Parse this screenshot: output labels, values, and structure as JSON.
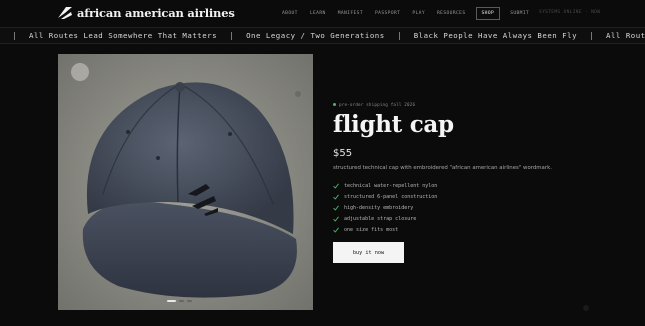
{
  "brand": {
    "name": "african american airlines",
    "logo_icon": "plane-wing-logo-icon"
  },
  "nav": {
    "links": [
      "ABOUT",
      "LEARN",
      "MANIFEST",
      "PASSPORT",
      "PLAY",
      "RESOURCES",
      "SHOP",
      "SUBMIT"
    ],
    "active": "SHOP",
    "status": "SYSTEMS ONLINE · NOW"
  },
  "ticker": {
    "items": [
      "All Routes Lead Somewhere That Matters",
      "One Legacy / Two Generations",
      "Black People Have Always Been Fly",
      "All Routes Lead"
    ]
  },
  "gallery": {
    "image_alt": "faded navy blue cap with embroidered logo",
    "slides": 3,
    "active_slide": 0
  },
  "product": {
    "eyebrow": "pre-order shipping fall 2026",
    "title": "flight cap",
    "price": "$55",
    "description": "structured technical cap with embroidered \"african american airlines\" wordmark.",
    "features": [
      "technical water-repellent nylon",
      "structured 6-panel construction",
      "high-density embroidery",
      "adjustable strap closure",
      "one size fits most"
    ],
    "buy_label": "buy it now"
  },
  "colors": {
    "background": "#0b0b0b",
    "accent_green": "#4fb36b",
    "button": "#f4f4f4"
  }
}
